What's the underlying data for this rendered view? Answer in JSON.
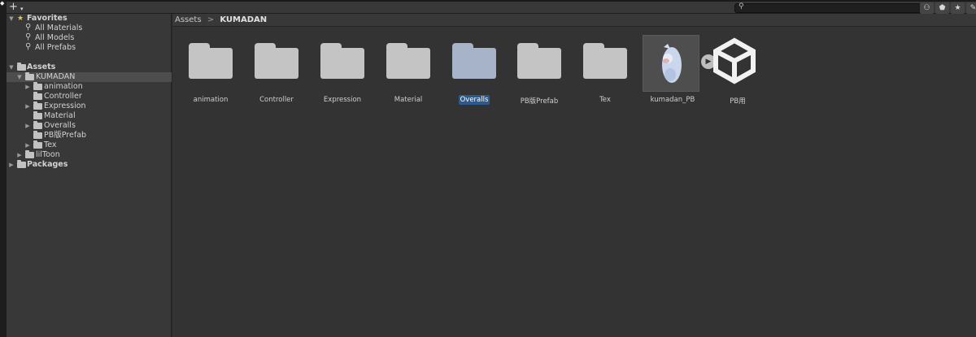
{
  "toolbar": {
    "add_label": "+",
    "add_arrow": "▾",
    "search": {
      "value": "",
      "placeholder": ""
    },
    "icons": [
      "scene-filter-icon",
      "label-tag-icon",
      "star-icon",
      "hidden-packages-icon"
    ]
  },
  "sidebar": {
    "favorites": {
      "label": "Favorites",
      "items": [
        {
          "label": "All Materials"
        },
        {
          "label": "All Models"
        },
        {
          "label": "All Prefabs"
        }
      ]
    },
    "assets": {
      "label": "Assets",
      "kumadan": {
        "label": "KUMADAN",
        "children": [
          {
            "label": "animation"
          },
          {
            "label": "Controller"
          },
          {
            "label": "Expression"
          },
          {
            "label": "Material"
          },
          {
            "label": "Overalls"
          },
          {
            "label": "PB版Prefab"
          },
          {
            "label": "Tex"
          }
        ]
      },
      "liltoon": {
        "label": "lilToon"
      }
    },
    "packages": {
      "label": "Packages"
    }
  },
  "main": {
    "breadcrumb": {
      "root": "Assets",
      "separator": ">",
      "current": "KUMADAN"
    },
    "items": [
      {
        "label": "animation",
        "type": "folder"
      },
      {
        "label": "Controller",
        "type": "folder"
      },
      {
        "label": "Expression",
        "type": "folder"
      },
      {
        "label": "Material",
        "type": "folder"
      },
      {
        "label": "Overalls",
        "type": "folder",
        "selected": true
      },
      {
        "label": "PB版Prefab",
        "type": "folder"
      },
      {
        "label": "Tex",
        "type": "folder"
      },
      {
        "label": "kumadan_PB",
        "type": "prefab"
      },
      {
        "label": "PB用",
        "type": "unity-scene"
      }
    ]
  },
  "colors": {
    "selection": "#2d5a8c",
    "folder": "#c4c4c4",
    "folder_selected": "#a7b3c9",
    "panel": "#383838",
    "content": "#333333"
  }
}
